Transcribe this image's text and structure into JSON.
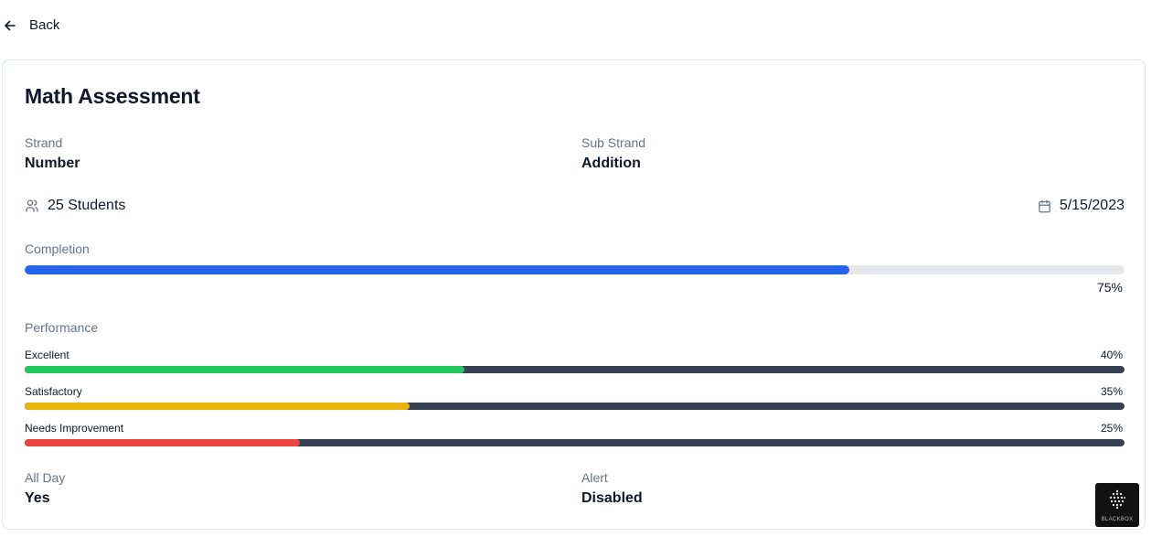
{
  "nav": {
    "back_label": "Back",
    "back_icon": "arrow-left-icon"
  },
  "assessment": {
    "title": "Math Assessment",
    "strand_label": "Strand",
    "strand_value": "Number",
    "sub_strand_label": "Sub Strand",
    "sub_strand_value": "Addition",
    "students": "25 Students",
    "students_icon": "users-icon",
    "date": "5/15/2023",
    "date_icon": "calendar-icon"
  },
  "completion": {
    "label": "Completion",
    "percent_text": "75%",
    "value": 0.75,
    "fill_color": "#2563eb",
    "track_color": "#e5e7eb"
  },
  "performance": {
    "label": "Performance",
    "track_color": "#374151",
    "items": [
      {
        "label": "Excellent",
        "percent_text": "40%",
        "value": 0.4,
        "color": "#22c55e"
      },
      {
        "label": "Satisfactory",
        "percent_text": "35%",
        "value": 0.35,
        "color": "#eab308"
      },
      {
        "label": "Needs Improvement",
        "percent_text": "25%",
        "value": 0.25,
        "color": "#ef4444"
      }
    ]
  },
  "settings": {
    "all_day_label": "All Day",
    "all_day_value": "Yes",
    "alert_label": "Alert",
    "alert_value": "Disabled"
  },
  "watermark": {
    "text": "BLACKBOX"
  }
}
